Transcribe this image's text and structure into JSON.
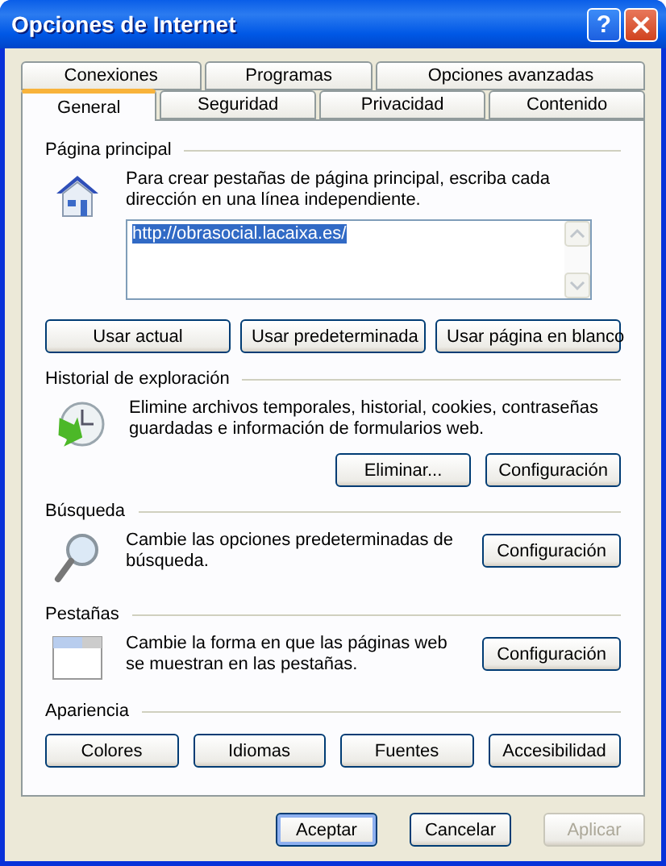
{
  "window": {
    "title": "Opciones de Internet",
    "help": "?"
  },
  "tabs": [
    [
      {
        "label": "Conexiones",
        "selected": false
      },
      {
        "label": "Programas",
        "selected": false
      },
      {
        "label": "Opciones avanzadas",
        "selected": false
      }
    ],
    [
      {
        "label": "General",
        "selected": true
      },
      {
        "label": "Seguridad",
        "selected": false
      },
      {
        "label": "Privacidad",
        "selected": false
      },
      {
        "label": "Contenido",
        "selected": false
      }
    ]
  ],
  "sections": [
    {
      "kind": "home",
      "title": "Página principal",
      "description": "Para crear pestañas de página principal, escriba cada dirección en una línea independiente.",
      "value": "http://obrasocial.lacaixa.es/",
      "buttons": [
        "Usar actual",
        "Usar predeterminada",
        "Usar página en blanco"
      ]
    },
    {
      "kind": "history",
      "title": "Historial de exploración",
      "description": "Elimine archivos temporales, historial, cookies, contraseñas guardadas e información de formularios web.",
      "buttons": [
        "Eliminar...",
        "Configuración"
      ]
    },
    {
      "kind": "search",
      "title": "Búsqueda",
      "description": "Cambie las opciones predeterminadas de búsqueda.",
      "buttons": [
        "Configuración"
      ]
    },
    {
      "kind": "tabs",
      "title": "Pestañas",
      "description": "Cambie la forma en que las páginas web se muestran en las pestañas.",
      "buttons": [
        "Configuración"
      ]
    },
    {
      "kind": "appearance",
      "title": "Apariencia",
      "buttons": [
        "Colores",
        "Idiomas",
        "Fuentes",
        "Accesibilidad"
      ]
    }
  ],
  "footer": [
    {
      "label": "Aceptar",
      "default": true,
      "disabled": false
    },
    {
      "label": "Cancelar",
      "default": false,
      "disabled": false
    },
    {
      "label": "Aplicar",
      "default": false,
      "disabled": true
    }
  ]
}
